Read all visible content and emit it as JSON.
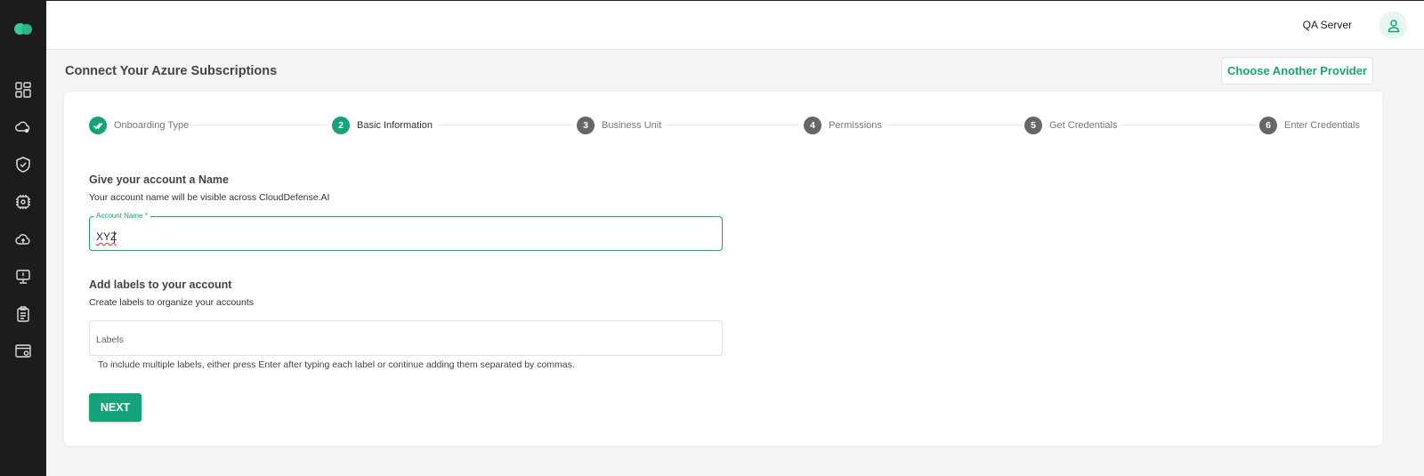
{
  "header": {
    "server_name": "QA Server"
  },
  "sidebar": {
    "items": [
      {
        "icon": "dashboard-icon"
      },
      {
        "icon": "cloud-settings-icon"
      },
      {
        "icon": "shield-check-icon"
      },
      {
        "icon": "chip-settings-icon"
      },
      {
        "icon": "cloud-upload-icon"
      },
      {
        "icon": "monitor-alert-icon"
      },
      {
        "icon": "clipboard-icon"
      },
      {
        "icon": "browser-settings-icon"
      }
    ]
  },
  "page": {
    "title": "Connect Your Azure Subscriptions",
    "provider_button": "Choose Another Provider"
  },
  "stepper": {
    "steps": [
      {
        "number": "",
        "label": "Onboarding Type",
        "status": "done"
      },
      {
        "number": "2",
        "label": "Basic Information",
        "status": "active"
      },
      {
        "number": "3",
        "label": "Business Unit",
        "status": "pending"
      },
      {
        "number": "4",
        "label": "Permissions",
        "status": "pending"
      },
      {
        "number": "5",
        "label": "Get Credentials",
        "status": "pending"
      },
      {
        "number": "6",
        "label": "Enter Credentials",
        "status": "pending"
      }
    ]
  },
  "form": {
    "name_section": {
      "heading": "Give your account a Name",
      "subtext": "Your account name will be visible across CloudDefense.AI",
      "field_label": "Account Name *",
      "value": "XYZ"
    },
    "labels_section": {
      "heading": "Add labels to your account",
      "subtext": "Create labels to organize your accounts",
      "placeholder": "Labels",
      "helper": "To include multiple labels, either press Enter after typing each label or continue adding them separated by commas."
    },
    "next_button": "NEXT"
  },
  "colors": {
    "accent": "#16a37a",
    "sidebar_bg": "#1c1c1c",
    "page_bg": "#f4f5f7",
    "pending_step": "#666666"
  }
}
